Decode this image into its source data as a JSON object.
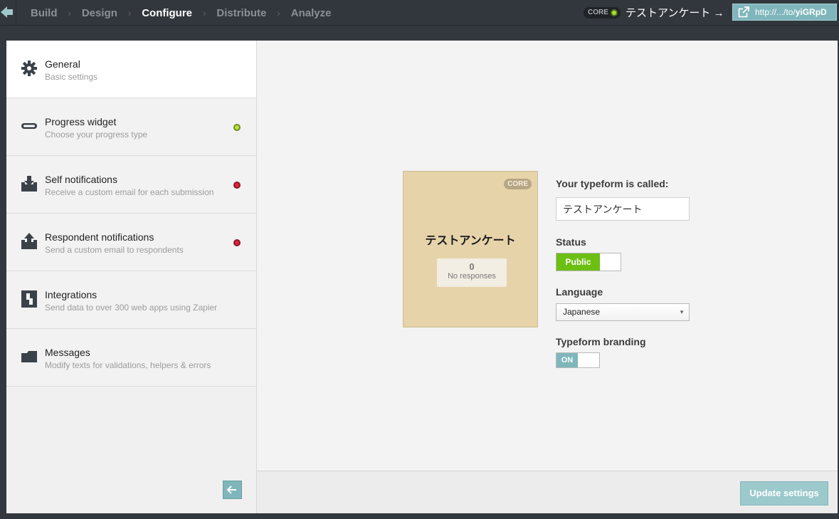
{
  "nav": {
    "items": [
      {
        "label": "Build",
        "active": false
      },
      {
        "label": "Design",
        "active": false
      },
      {
        "label": "Configure",
        "active": true
      },
      {
        "label": "Distribute",
        "active": false
      },
      {
        "label": "Analyze",
        "active": false
      }
    ],
    "separator": "›"
  },
  "topbar": {
    "plan_badge": "CORE",
    "form_title": "テストアンケート →",
    "url_prefix": "http://.../to/",
    "url_id": "yiGRpD",
    "icons": {
      "back": "back-arrow-icon",
      "external": "external-link-icon"
    },
    "accent_color": "#7fb6bb"
  },
  "sidebar": {
    "items": [
      {
        "title": "General",
        "subtitle": "Basic settings",
        "icon": "gear-icon",
        "status": null,
        "active": true
      },
      {
        "title": "Progress widget",
        "subtitle": "Choose your progress type",
        "icon": "progress-bar-icon",
        "status": "green",
        "active": false
      },
      {
        "title": "Self notifications",
        "subtitle": "Receive a custom email for each submission",
        "icon": "inbox-download-icon",
        "status": "red",
        "active": false
      },
      {
        "title": "Respondent notifications",
        "subtitle": "Send a custom email to respondents",
        "icon": "inbox-upload-icon",
        "status": "red",
        "active": false
      },
      {
        "title": "Integrations",
        "subtitle": "Send data to over 300 web apps using Zapier",
        "icon": "integrations-icon",
        "status": null,
        "active": false
      },
      {
        "title": "Messages",
        "subtitle": "Modify texts for validations, helpers & errors",
        "icon": "folder-icon",
        "status": null,
        "active": false
      }
    ],
    "collapse_icon": "arrow-left-icon"
  },
  "card": {
    "badge": "CORE",
    "title": "テストアンケート",
    "responses_count": "0",
    "responses_label": "No responses"
  },
  "form": {
    "name_label": "Your typeform is called:",
    "name_value": "テストアンケート",
    "status_label": "Status",
    "status_value": "Public",
    "status_color": "#6cbf13",
    "language_label": "Language",
    "language_value": "Japanese",
    "branding_label": "Typeform branding",
    "branding_value": "ON",
    "branding_color": "#7fb6bb"
  },
  "footer": {
    "update_label": "Update settings"
  }
}
